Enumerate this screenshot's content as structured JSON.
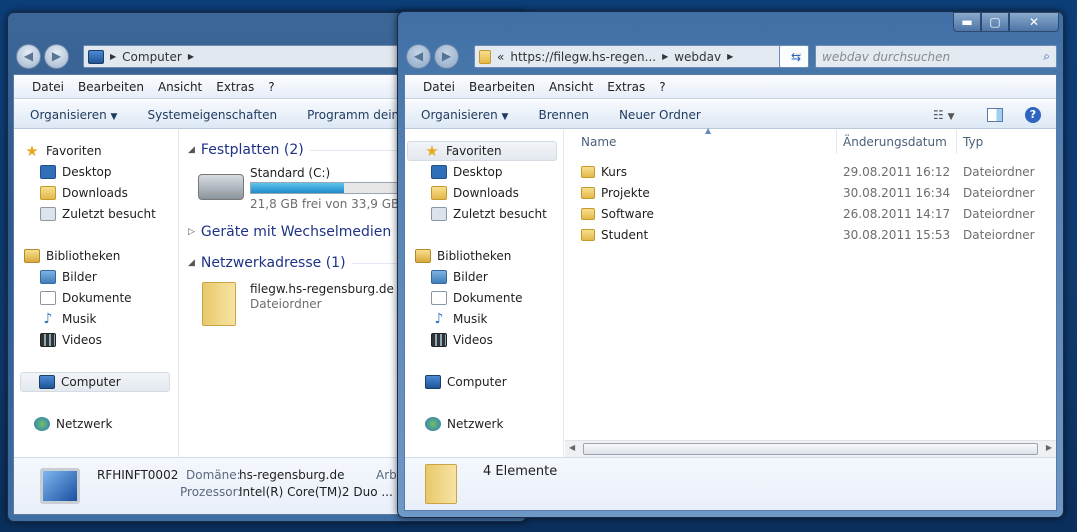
{
  "left_window": {
    "address": {
      "items": [
        "Computer"
      ]
    },
    "menu": [
      "Datei",
      "Bearbeiten",
      "Ansicht",
      "Extras",
      "?"
    ],
    "toolbar": {
      "organize": "Organisieren",
      "items": [
        "Systemeigenschaften",
        "Programm deinstallie"
      ]
    },
    "nav": {
      "favorites": "Favoriten",
      "fav_items": [
        "Desktop",
        "Downloads",
        "Zuletzt besucht"
      ],
      "libraries": "Bibliotheken",
      "lib_items": [
        "Bilder",
        "Dokumente",
        "Musik",
        "Videos"
      ],
      "computer": "Computer",
      "network": "Netzwerk"
    },
    "content": {
      "group_drives": "Festplatten (2)",
      "drive": {
        "name": "Standard (C:)",
        "free": "21,8 GB frei von 33,9 GB",
        "used_fraction": 0.36
      },
      "group_removable": "Geräte mit Wechselmedien (2)",
      "group_network": "Netzwerkadresse (1)",
      "network_item": {
        "name": "filegw.hs-regensburg.de",
        "type": "Dateiordner"
      }
    },
    "details": {
      "computer_name": "RFHINFT0002",
      "domain_label": "Domäne:",
      "domain": "hs-regensburg.de",
      "workgroup_label": "Arbei",
      "processor_label": "Prozessor:",
      "processor": "Intel(R) Core(TM)2 Duo ..."
    }
  },
  "right_window": {
    "address": {
      "prefix": "«",
      "items": [
        "https://filegw.hs-regen...",
        "webdav"
      ]
    },
    "search_placeholder": "webdav durchsuchen",
    "menu": [
      "Datei",
      "Bearbeiten",
      "Ansicht",
      "Extras",
      "?"
    ],
    "toolbar": {
      "organize": "Organisieren",
      "items": [
        "Brennen",
        "Neuer Ordner"
      ]
    },
    "nav": {
      "favorites": "Favoriten",
      "fav_items": [
        "Desktop",
        "Downloads",
        "Zuletzt besucht"
      ],
      "libraries": "Bibliotheken",
      "lib_items": [
        "Bilder",
        "Dokumente",
        "Musik",
        "Videos"
      ],
      "computer": "Computer",
      "network": "Netzwerk"
    },
    "columns": [
      "Name",
      "Änderungsdatum",
      "Typ"
    ],
    "files": [
      {
        "name": "Kurs",
        "date": "29.08.2011 16:12",
        "type": "Dateiordner"
      },
      {
        "name": "Projekte",
        "date": "30.08.2011 16:34",
        "type": "Dateiordner"
      },
      {
        "name": "Software",
        "date": "26.08.2011 14:17",
        "type": "Dateiordner"
      },
      {
        "name": "Student",
        "date": "30.08.2011 15:53",
        "type": "Dateiordner"
      }
    ],
    "details": {
      "count": "4 Elemente"
    }
  }
}
